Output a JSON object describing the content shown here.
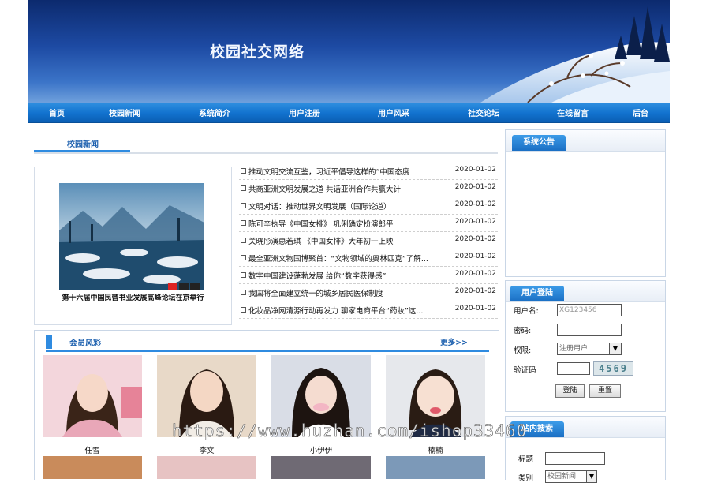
{
  "site_title": "校园社交网络",
  "nav": [
    "首页",
    "校园新闻",
    "系统简介",
    "用户注册",
    "用户风采",
    "社交论坛",
    "在线留言",
    "后台"
  ],
  "news_section": {
    "label": "校园新闻",
    "photo_caption": "第十六届中国民营书业发展高峰论坛在京举行",
    "items": [
      {
        "title": "推动文明交流互鉴，习近平倡导这样的“中国态度",
        "date": "2020-01-02"
      },
      {
        "title": "共商亚洲文明发展之道 共话亚洲合作共赢大计",
        "date": "2020-01-02"
      },
      {
        "title": "文明对话：推动世界文明发展（国际论道）",
        "date": "2020-01-02"
      },
      {
        "title": "陈可辛执导《中国女排》 巩俐确定扮演郎平",
        "date": "2020-01-02"
      },
      {
        "title": "关晓彤演惠若琪 《中国女排》大年初一上映",
        "date": "2020-01-02"
      },
      {
        "title": "最全亚洲文物国博聚首：“文物领域的奥林匹克”了解...",
        "date": "2020-01-02"
      },
      {
        "title": "数字中国建设蓬勃发展 给你“数字获得感”",
        "date": "2020-01-02"
      },
      {
        "title": "我国将全面建立统一的城乡居民医保制度",
        "date": "2020-01-02"
      },
      {
        "title": "化妆品净网清源行动再发力 聊家电商平台“药妆”这...",
        "date": "2020-01-02"
      }
    ]
  },
  "members_section": {
    "label": "会员风彩",
    "more": "更多>>",
    "members": [
      "任雪",
      "李文",
      "小伊伊",
      "楠楠"
    ]
  },
  "announcement": {
    "label": "系统公告"
  },
  "login": {
    "label": "用户登陆",
    "username_label": "用户名:",
    "username_value": "XG123456",
    "password_label": "密码:",
    "role_label": "权限:",
    "role_selected": "注册用户",
    "captcha_label": "验证码",
    "captcha_text": "4569",
    "login_button": "登陆",
    "reset_button": "重置"
  },
  "search": {
    "label": "站内搜索",
    "title_label": "标题",
    "category_label": "类别",
    "category_selected": "校园新闻"
  },
  "watermark": "https://www.huzhan.com/ishop33460",
  "colors": {
    "nav_blue": "#1273cf",
    "accent_blue": "#2f8be0",
    "link_blue": "#1b5fae"
  }
}
